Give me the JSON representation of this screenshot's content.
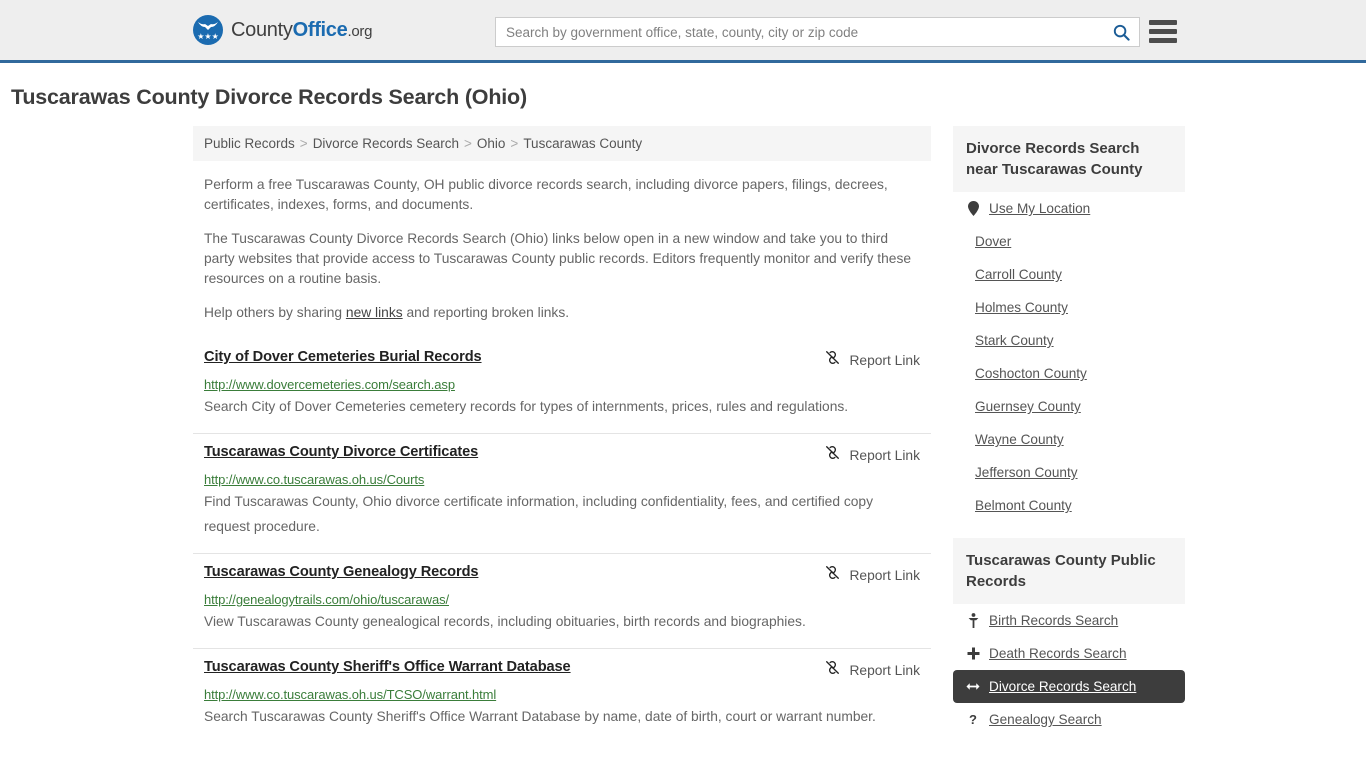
{
  "header": {
    "logo": {
      "part1": "County",
      "part2": "Office",
      "part3": ".org",
      "icon": "eagle-shield-logo-icon",
      "stars": "★★★"
    },
    "search": {
      "placeholder": "Search by government office, state, county, city or zip code",
      "value": "",
      "icon": "search-icon"
    },
    "menu_icon": "hamburger-menu-icon",
    "accent_color": "#31699c"
  },
  "page": {
    "title": "Tuscarawas County Divorce Records Search (Ohio)"
  },
  "breadcrumb": {
    "items": [
      {
        "label": "Public Records"
      },
      {
        "label": "Divorce Records Search"
      },
      {
        "label": "Ohio"
      },
      {
        "label": "Tuscarawas County"
      }
    ],
    "separator": ">"
  },
  "intro": {
    "p1": "Perform a free Tuscarawas County, OH public divorce records search, including divorce papers, filings, decrees, certificates, indexes, forms, and documents.",
    "p2": "The Tuscarawas County Divorce Records Search (Ohio) links below open in a new window and take you to third party websites that provide access to Tuscarawas County public records. Editors frequently monitor and verify these resources on a routine basis.",
    "p3_before": "Help others by sharing ",
    "p3_link": "new links",
    "p3_after": " and reporting broken links."
  },
  "results": {
    "report_label": "Report Link",
    "report_icon": "broken-link-icon",
    "items": [
      {
        "title": "City of Dover Cemeteries Burial Records",
        "url": "http://www.dovercemeteries.com/search.asp",
        "description": "Search City of Dover Cemeteries cemetery records for types of internments, prices, rules and regulations."
      },
      {
        "title": "Tuscarawas County Divorce Certificates",
        "url": "http://www.co.tuscarawas.oh.us/Courts",
        "description": "Find Tuscarawas County, Ohio divorce certificate information, including confidentiality, fees, and certified copy request procedure."
      },
      {
        "title": "Tuscarawas County Genealogy Records",
        "url": "http://genealogytrails.com/ohio/tuscarawas/",
        "description": "View Tuscarawas County genealogical records, including obituaries, birth records and biographies."
      },
      {
        "title": "Tuscarawas County Sheriff's Office Warrant Database",
        "url": "http://www.co.tuscarawas.oh.us/TCSO/warrant.html",
        "description": "Search Tuscarawas County Sheriff's Office Warrant Database by name, date of birth, court or warrant number."
      }
    ]
  },
  "sidebar": {
    "nearby": {
      "heading": "Divorce Records Search near Tuscarawas County",
      "items": [
        {
          "label": "Use My Location",
          "icon": "map-pin-icon"
        },
        {
          "label": "Dover",
          "icon": ""
        },
        {
          "label": "Carroll County",
          "icon": ""
        },
        {
          "label": "Holmes County",
          "icon": ""
        },
        {
          "label": "Stark County",
          "icon": ""
        },
        {
          "label": "Coshocton County",
          "icon": ""
        },
        {
          "label": "Guernsey County",
          "icon": ""
        },
        {
          "label": "Wayne County",
          "icon": ""
        },
        {
          "label": "Jefferson County",
          "icon": ""
        },
        {
          "label": "Belmont County",
          "icon": ""
        }
      ]
    },
    "public_records": {
      "heading": "Tuscarawas County Public Records",
      "items": [
        {
          "label": "Birth Records Search",
          "icon": "child-icon",
          "active": false
        },
        {
          "label": "Death Records Search",
          "icon": "plus-cross-icon",
          "active": false
        },
        {
          "label": "Divorce Records Search",
          "icon": "left-right-arrow-icon",
          "active": true
        },
        {
          "label": "Genealogy Search",
          "icon": "question-mark-icon",
          "active": false
        }
      ]
    }
  }
}
